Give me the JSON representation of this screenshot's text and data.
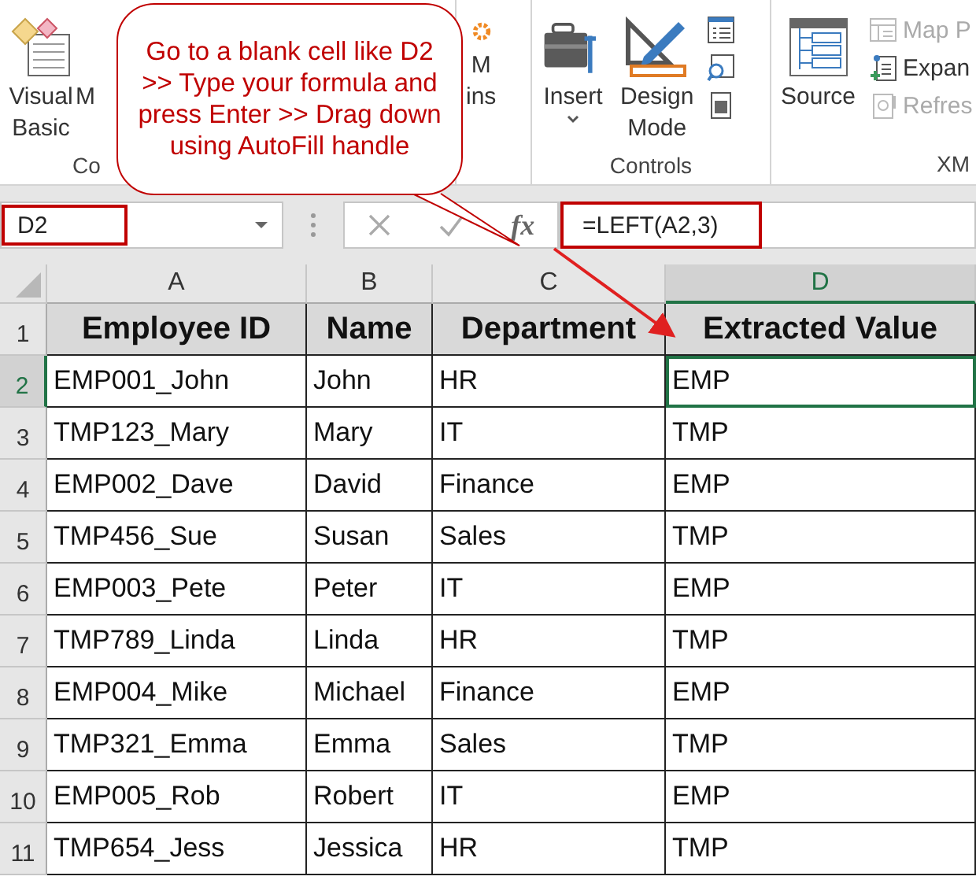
{
  "ribbon": {
    "groups": [
      {
        "label": "Co",
        "kind": "code",
        "buttons": [
          {
            "kind": "visual-basic",
            "lines": [
              "Visual",
              "Basic"
            ]
          },
          {
            "kind": "macros",
            "lines": [
              "M"
            ]
          }
        ]
      },
      {
        "kind": "addins",
        "buttons": [
          {
            "kind": "com-addins",
            "lines": [
              "M",
              "ins"
            ]
          }
        ]
      },
      {
        "label": "Controls",
        "kind": "controls",
        "buttons": [
          {
            "kind": "insert",
            "lines": [
              "Insert"
            ]
          },
          {
            "kind": "design-mode",
            "lines": [
              "Design",
              "Mode"
            ]
          }
        ],
        "small": [
          {
            "kind": "properties",
            "disabled": false
          },
          {
            "kind": "view-code",
            "disabled": false
          },
          {
            "kind": "run-dialog",
            "disabled": false
          }
        ]
      },
      {
        "label": "XM",
        "kind": "xml",
        "buttons": [
          {
            "kind": "source",
            "lines": [
              "Source"
            ]
          }
        ],
        "small": [
          {
            "kind": "map",
            "label": "Map P",
            "disabled": true
          },
          {
            "kind": "expand",
            "label": "Expan",
            "disabled": false
          },
          {
            "kind": "refresh",
            "label": "Refres",
            "disabled": true
          }
        ]
      }
    ]
  },
  "callout": {
    "text": "Go to a blank cell like D2 >> Type your formula and press Enter >> Drag down using AutoFill handle"
  },
  "formula_bar": {
    "name_box": "D2",
    "formula": "=LEFT(A2,3)",
    "fx": "fx"
  },
  "sheet": {
    "columns": [
      {
        "label": "A",
        "selected": false
      },
      {
        "label": "B",
        "selected": false
      },
      {
        "label": "C",
        "selected": false
      },
      {
        "label": "D",
        "selected": true
      }
    ],
    "header_row": {
      "number": "1",
      "cells": [
        "Employee ID",
        "Name",
        "Department",
        "Extracted Value"
      ]
    },
    "rows": [
      {
        "number": "2",
        "selected": true,
        "cells": [
          "EMP001_John",
          "John",
          "HR",
          "EMP"
        ]
      },
      {
        "number": "3",
        "selected": false,
        "cells": [
          "TMP123_Mary",
          "Mary",
          "IT",
          "TMP"
        ]
      },
      {
        "number": "4",
        "selected": false,
        "cells": [
          "EMP002_Dave",
          "David",
          "Finance",
          "EMP"
        ]
      },
      {
        "number": "5",
        "selected": false,
        "cells": [
          "TMP456_Sue",
          "Susan",
          "Sales",
          "TMP"
        ]
      },
      {
        "number": "6",
        "selected": false,
        "cells": [
          "EMP003_Pete",
          "Peter",
          "IT",
          "EMP"
        ]
      },
      {
        "number": "7",
        "selected": false,
        "cells": [
          "TMP789_Linda",
          "Linda",
          "HR",
          "TMP"
        ]
      },
      {
        "number": "8",
        "selected": false,
        "cells": [
          "EMP004_Mike",
          "Michael",
          "Finance",
          "EMP"
        ]
      },
      {
        "number": "9",
        "selected": false,
        "cells": [
          "TMP321_Emma",
          "Emma",
          "Sales",
          "TMP"
        ]
      },
      {
        "number": "10",
        "selected": false,
        "cells": [
          "EMP005_Rob",
          "Robert",
          "IT",
          "EMP"
        ]
      },
      {
        "number": "11",
        "selected": false,
        "cells": [
          "TMP654_Jess",
          "Jessica",
          "HR",
          "TMP"
        ]
      }
    ]
  }
}
